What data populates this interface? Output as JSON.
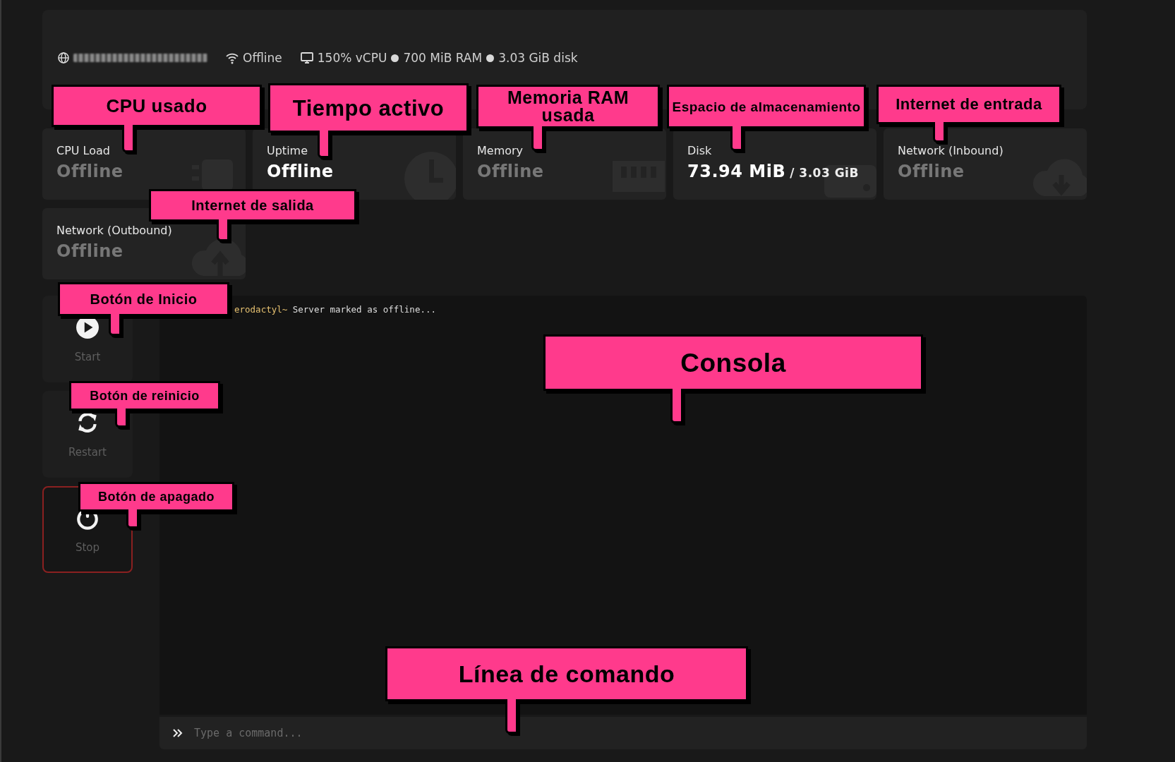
{
  "header": {
    "status": "Offline",
    "specs": [
      "150% vCPU",
      "700 MiB RAM",
      "3.03 GiB disk"
    ]
  },
  "stats": [
    {
      "label": "CPU Load",
      "value": "Offline",
      "dimmed": true
    },
    {
      "label": "Uptime",
      "value": "Offline",
      "dimmed": false
    },
    {
      "label": "Memory",
      "value": "Offline",
      "dimmed": true
    },
    {
      "label": "Disk",
      "value": "73.94 MiB",
      "limit": "/ 3.03 GiB",
      "dimmed": false
    },
    {
      "label": "Network (Inbound)",
      "value": "Offline",
      "dimmed": true
    },
    {
      "label": "Network (Outbound)",
      "value": "Offline",
      "dimmed": true
    }
  ],
  "power_buttons": [
    {
      "kind": "start",
      "label": "Start",
      "danger": false
    },
    {
      "kind": "restart",
      "label": "Restart",
      "danger": false
    },
    {
      "kind": "stop",
      "label": "Stop",
      "danger": true
    }
  ],
  "console": {
    "lines": [
      {
        "prefix": "erodactyl~",
        "text": "Server marked as offline..."
      }
    ],
    "placeholder": "Type a command..."
  },
  "callouts": [
    "CPU usado",
    "Tiempo activo",
    "Memoria RAM usada",
    "Espacio de almacenamiento",
    "Internet de entrada",
    "Internet de salida",
    "Botón de Inicio",
    "Botón de reinicio",
    "Botón de apagado",
    "Consola",
    "Línea de comando"
  ]
}
